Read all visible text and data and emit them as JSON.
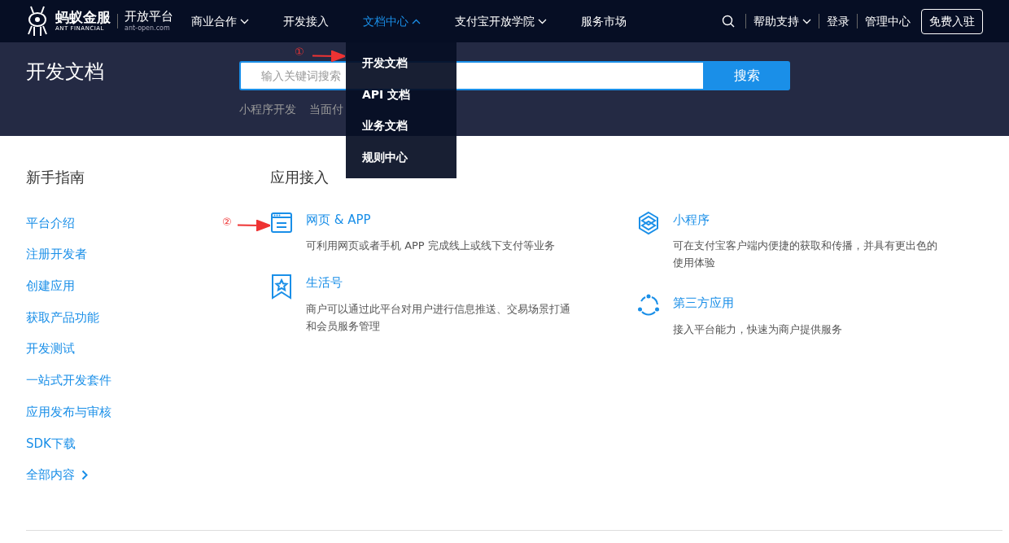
{
  "logo": {
    "name": "蚂蚁金服",
    "name_en": "ANT FINANCIAL",
    "product": "开放平台",
    "domain": "ant-open.com"
  },
  "nav": [
    {
      "label": "商业合作",
      "dropdown": true,
      "selected": false
    },
    {
      "label": "开发接入",
      "dropdown": false,
      "selected": false
    },
    {
      "label": "文档中心",
      "dropdown": true,
      "selected": true
    },
    {
      "label": "支付宝开放学院",
      "dropdown": true,
      "selected": false
    },
    {
      "label": "服务市场",
      "dropdown": false,
      "selected": false
    }
  ],
  "nav_right": {
    "help": "帮助支持",
    "login": "登录",
    "console": "管理中心",
    "signup": "免费入驻"
  },
  "dropdown_menu": [
    "开发文档",
    "API 文档",
    "业务文档",
    "规则中心"
  ],
  "hero": {
    "title": "开发文档",
    "search": {
      "placeholder": "输入关键词搜索",
      "button": "搜索"
    },
    "tags": [
      "小程序开发",
      "当面付"
    ]
  },
  "guide": {
    "title": "新手指南",
    "links": [
      {
        "label": "平台介绍",
        "more": false
      },
      {
        "label": "注册开发者",
        "more": false
      },
      {
        "label": "创建应用",
        "more": false
      },
      {
        "label": "获取产品功能",
        "more": false
      },
      {
        "label": "开发测试",
        "more": false
      },
      {
        "label": "一站式开发套件",
        "more": false
      },
      {
        "label": "应用发布与审核",
        "more": false
      },
      {
        "label": "SDK下载",
        "more": false
      },
      {
        "label": "全部内容",
        "more": true
      }
    ]
  },
  "access": {
    "title": "应用接入",
    "columns": [
      [
        {
          "kind": "web",
          "title": "网页 & APP",
          "desc": "可利用网页或者手机 APP 完成线上或线下支付等业务"
        },
        {
          "kind": "life",
          "title": "生活号",
          "desc": "商户可以通过此平台对用户进行信息推送、交易场景打通和会员服务管理"
        }
      ],
      [
        {
          "kind": "mini",
          "title": "小程序",
          "desc": "可在支付宝客户端内便捷的获取和传播，并具有更出色的使用体验"
        },
        {
          "kind": "third",
          "title": "第三方应用",
          "desc": "接入平台能力，快速为商户提供服务"
        }
      ]
    ]
  },
  "annotations": [
    {
      "label": "①"
    },
    {
      "label": "②"
    }
  ]
}
